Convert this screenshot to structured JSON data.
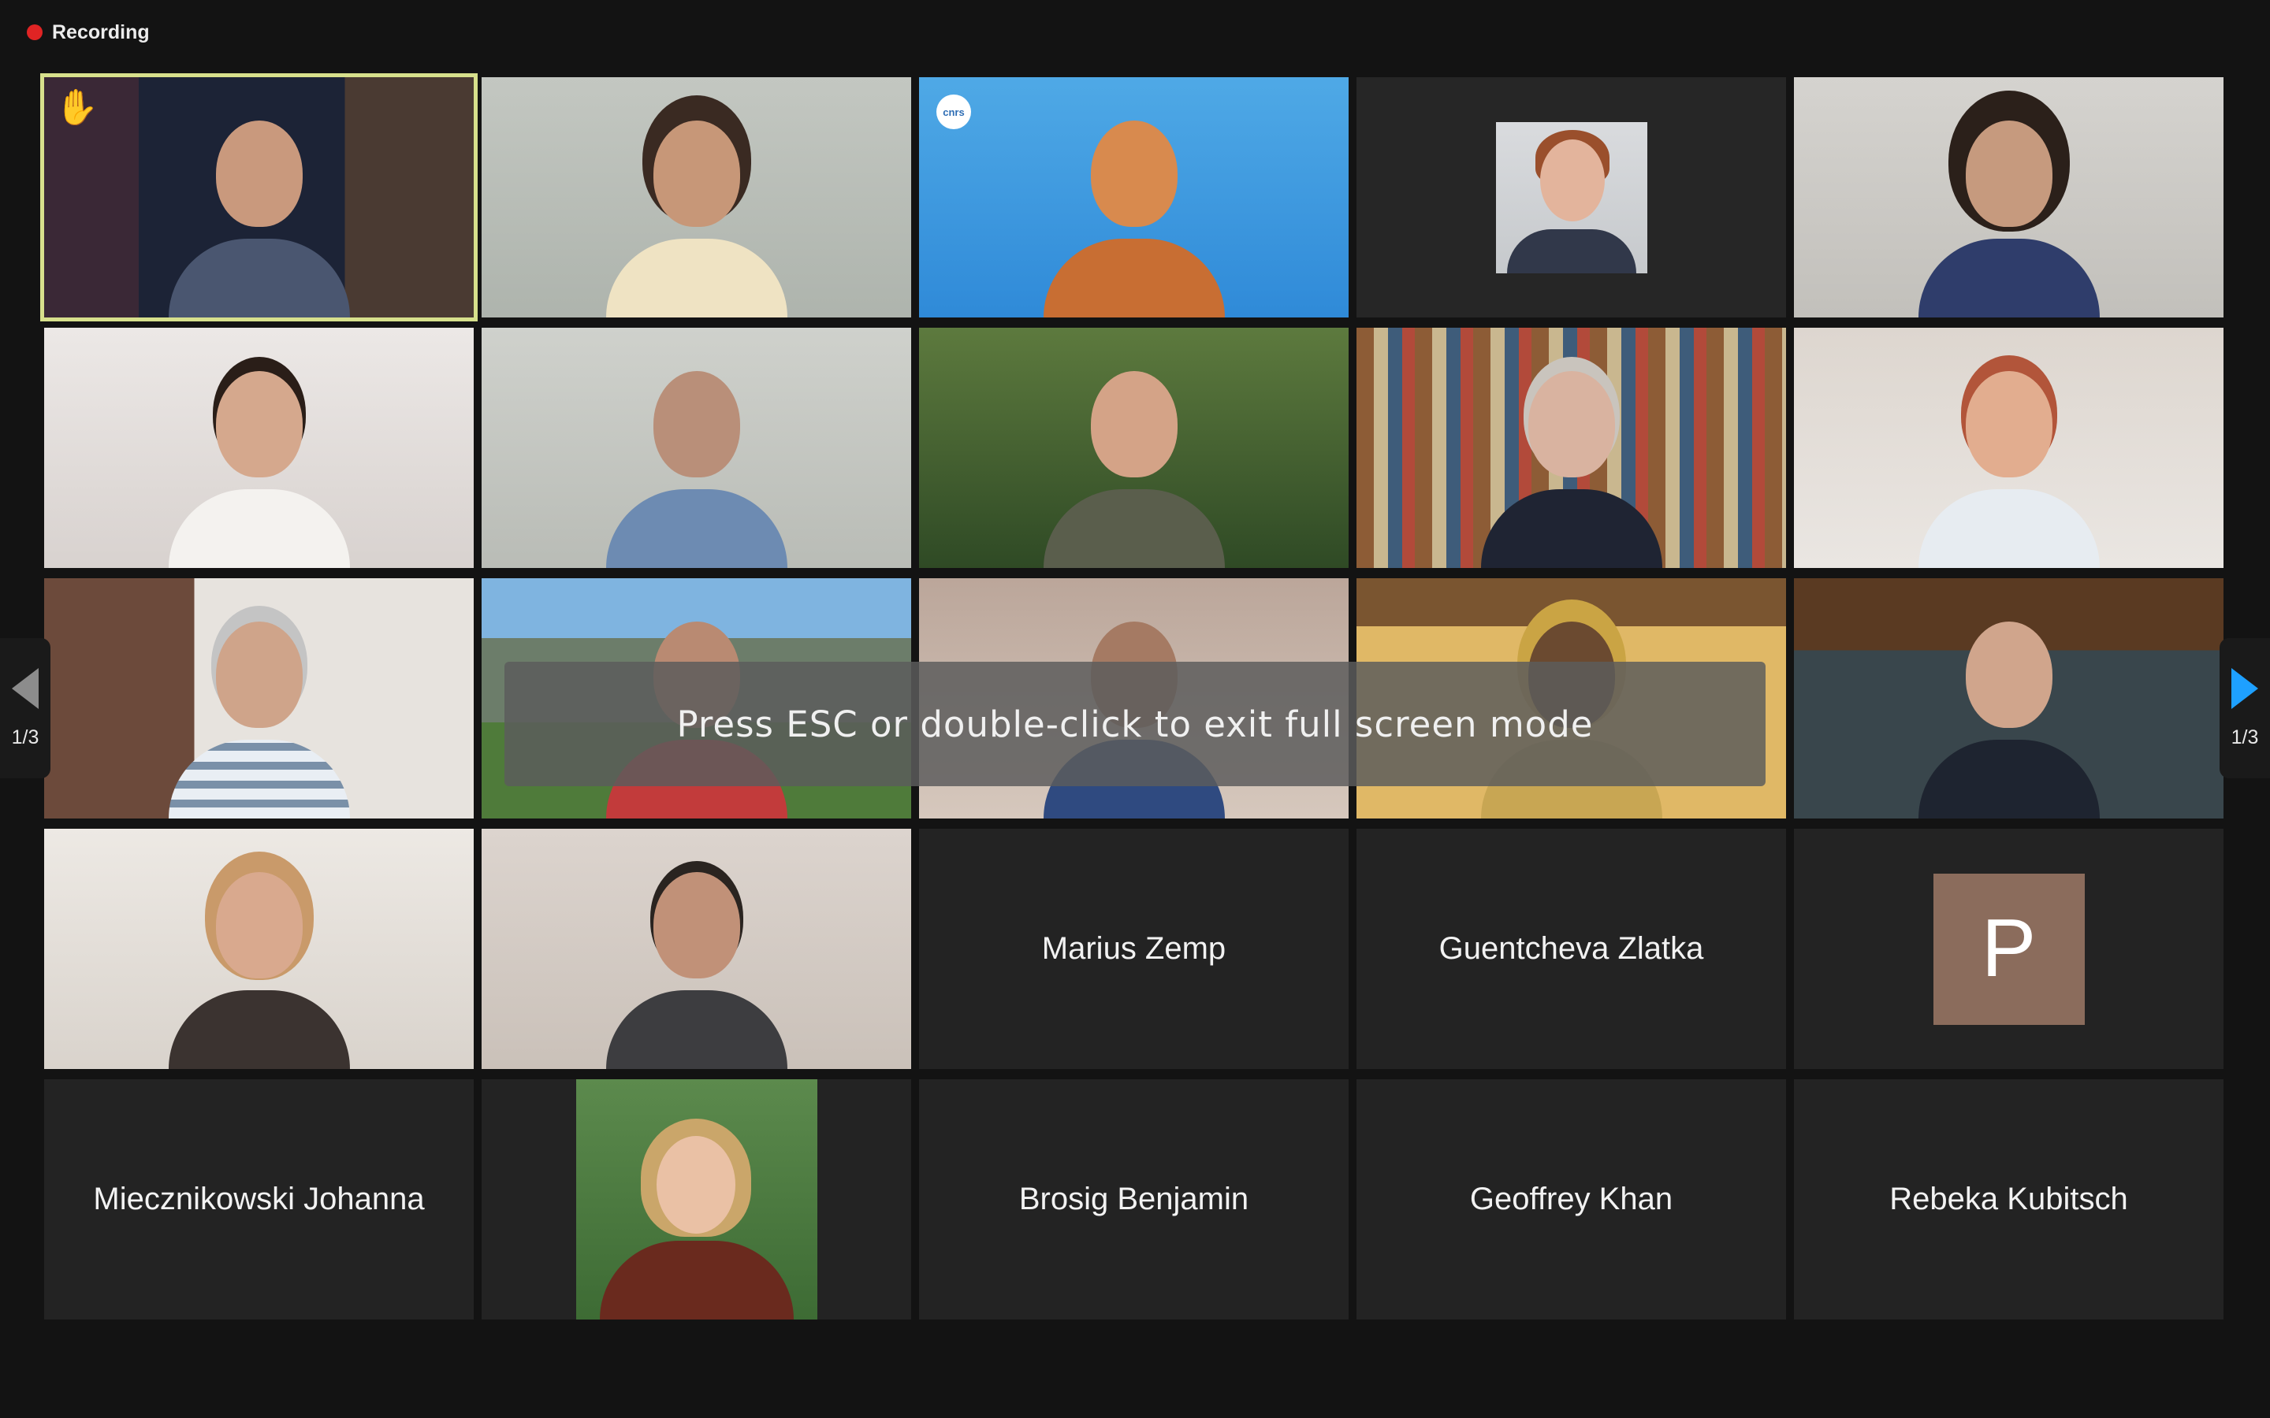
{
  "recording": {
    "label": "Recording",
    "dot_color": "#e02424"
  },
  "fullscreen_notice": "Press ESC or double-click to exit full screen mode",
  "pagination": {
    "prev_page": "1/3",
    "next_page": "1/3"
  },
  "tiles_text": {
    "marius": "Marius Zemp",
    "guentcheva": "Guentcheva Zlatka",
    "p_avatar": "P",
    "miecznikowski": "Miecznikowski Johanna",
    "brosig": "Brosig Benjamin",
    "geoffrey": "Geoffrey Khan",
    "rebeka": "Rebeka Kubitsch"
  },
  "logos": {
    "cnrs": "cnrs"
  },
  "icons": {
    "raised_hand": "raised-hand-icon"
  },
  "colors": {
    "active_speaker_border": "#d7e08c",
    "next_arrow": "#1ea0ff",
    "avatar_bg": "#8b6c5c"
  }
}
